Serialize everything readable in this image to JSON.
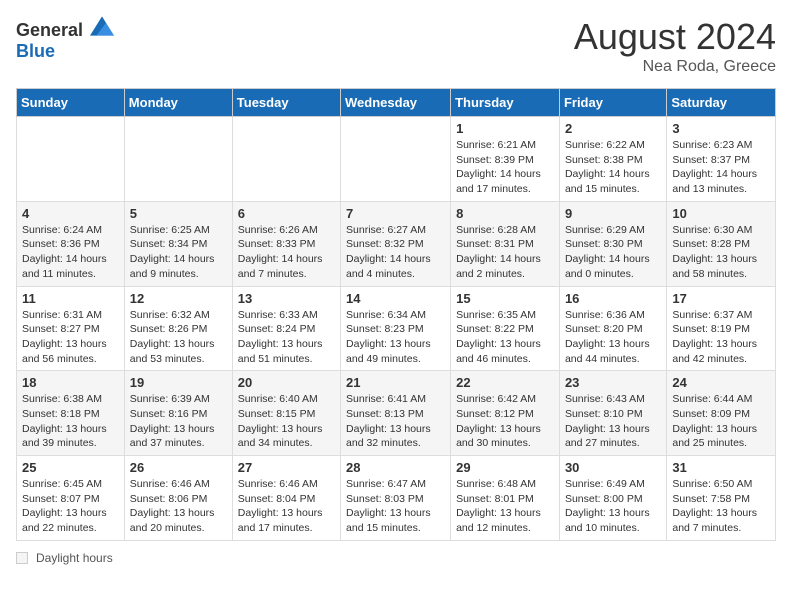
{
  "header": {
    "logo_general": "General",
    "logo_blue": "Blue",
    "month_year": "August 2024",
    "location": "Nea Roda, Greece"
  },
  "days_of_week": [
    "Sunday",
    "Monday",
    "Tuesday",
    "Wednesday",
    "Thursday",
    "Friday",
    "Saturday"
  ],
  "weeks": [
    [
      {
        "day": "",
        "info": ""
      },
      {
        "day": "",
        "info": ""
      },
      {
        "day": "",
        "info": ""
      },
      {
        "day": "",
        "info": ""
      },
      {
        "day": "1",
        "info": "Sunrise: 6:21 AM\nSunset: 8:39 PM\nDaylight: 14 hours and 17 minutes."
      },
      {
        "day": "2",
        "info": "Sunrise: 6:22 AM\nSunset: 8:38 PM\nDaylight: 14 hours and 15 minutes."
      },
      {
        "day": "3",
        "info": "Sunrise: 6:23 AM\nSunset: 8:37 PM\nDaylight: 14 hours and 13 minutes."
      }
    ],
    [
      {
        "day": "4",
        "info": "Sunrise: 6:24 AM\nSunset: 8:36 PM\nDaylight: 14 hours and 11 minutes."
      },
      {
        "day": "5",
        "info": "Sunrise: 6:25 AM\nSunset: 8:34 PM\nDaylight: 14 hours and 9 minutes."
      },
      {
        "day": "6",
        "info": "Sunrise: 6:26 AM\nSunset: 8:33 PM\nDaylight: 14 hours and 7 minutes."
      },
      {
        "day": "7",
        "info": "Sunrise: 6:27 AM\nSunset: 8:32 PM\nDaylight: 14 hours and 4 minutes."
      },
      {
        "day": "8",
        "info": "Sunrise: 6:28 AM\nSunset: 8:31 PM\nDaylight: 14 hours and 2 minutes."
      },
      {
        "day": "9",
        "info": "Sunrise: 6:29 AM\nSunset: 8:30 PM\nDaylight: 14 hours and 0 minutes."
      },
      {
        "day": "10",
        "info": "Sunrise: 6:30 AM\nSunset: 8:28 PM\nDaylight: 13 hours and 58 minutes."
      }
    ],
    [
      {
        "day": "11",
        "info": "Sunrise: 6:31 AM\nSunset: 8:27 PM\nDaylight: 13 hours and 56 minutes."
      },
      {
        "day": "12",
        "info": "Sunrise: 6:32 AM\nSunset: 8:26 PM\nDaylight: 13 hours and 53 minutes."
      },
      {
        "day": "13",
        "info": "Sunrise: 6:33 AM\nSunset: 8:24 PM\nDaylight: 13 hours and 51 minutes."
      },
      {
        "day": "14",
        "info": "Sunrise: 6:34 AM\nSunset: 8:23 PM\nDaylight: 13 hours and 49 minutes."
      },
      {
        "day": "15",
        "info": "Sunrise: 6:35 AM\nSunset: 8:22 PM\nDaylight: 13 hours and 46 minutes."
      },
      {
        "day": "16",
        "info": "Sunrise: 6:36 AM\nSunset: 8:20 PM\nDaylight: 13 hours and 44 minutes."
      },
      {
        "day": "17",
        "info": "Sunrise: 6:37 AM\nSunset: 8:19 PM\nDaylight: 13 hours and 42 minutes."
      }
    ],
    [
      {
        "day": "18",
        "info": "Sunrise: 6:38 AM\nSunset: 8:18 PM\nDaylight: 13 hours and 39 minutes."
      },
      {
        "day": "19",
        "info": "Sunrise: 6:39 AM\nSunset: 8:16 PM\nDaylight: 13 hours and 37 minutes."
      },
      {
        "day": "20",
        "info": "Sunrise: 6:40 AM\nSunset: 8:15 PM\nDaylight: 13 hours and 34 minutes."
      },
      {
        "day": "21",
        "info": "Sunrise: 6:41 AM\nSunset: 8:13 PM\nDaylight: 13 hours and 32 minutes."
      },
      {
        "day": "22",
        "info": "Sunrise: 6:42 AM\nSunset: 8:12 PM\nDaylight: 13 hours and 30 minutes."
      },
      {
        "day": "23",
        "info": "Sunrise: 6:43 AM\nSunset: 8:10 PM\nDaylight: 13 hours and 27 minutes."
      },
      {
        "day": "24",
        "info": "Sunrise: 6:44 AM\nSunset: 8:09 PM\nDaylight: 13 hours and 25 minutes."
      }
    ],
    [
      {
        "day": "25",
        "info": "Sunrise: 6:45 AM\nSunset: 8:07 PM\nDaylight: 13 hours and 22 minutes."
      },
      {
        "day": "26",
        "info": "Sunrise: 6:46 AM\nSunset: 8:06 PM\nDaylight: 13 hours and 20 minutes."
      },
      {
        "day": "27",
        "info": "Sunrise: 6:46 AM\nSunset: 8:04 PM\nDaylight: 13 hours and 17 minutes."
      },
      {
        "day": "28",
        "info": "Sunrise: 6:47 AM\nSunset: 8:03 PM\nDaylight: 13 hours and 15 minutes."
      },
      {
        "day": "29",
        "info": "Sunrise: 6:48 AM\nSunset: 8:01 PM\nDaylight: 13 hours and 12 minutes."
      },
      {
        "day": "30",
        "info": "Sunrise: 6:49 AM\nSunset: 8:00 PM\nDaylight: 13 hours and 10 minutes."
      },
      {
        "day": "31",
        "info": "Sunrise: 6:50 AM\nSunset: 7:58 PM\nDaylight: 13 hours and 7 minutes."
      }
    ]
  ],
  "footer": {
    "daylight_label": "Daylight hours"
  }
}
